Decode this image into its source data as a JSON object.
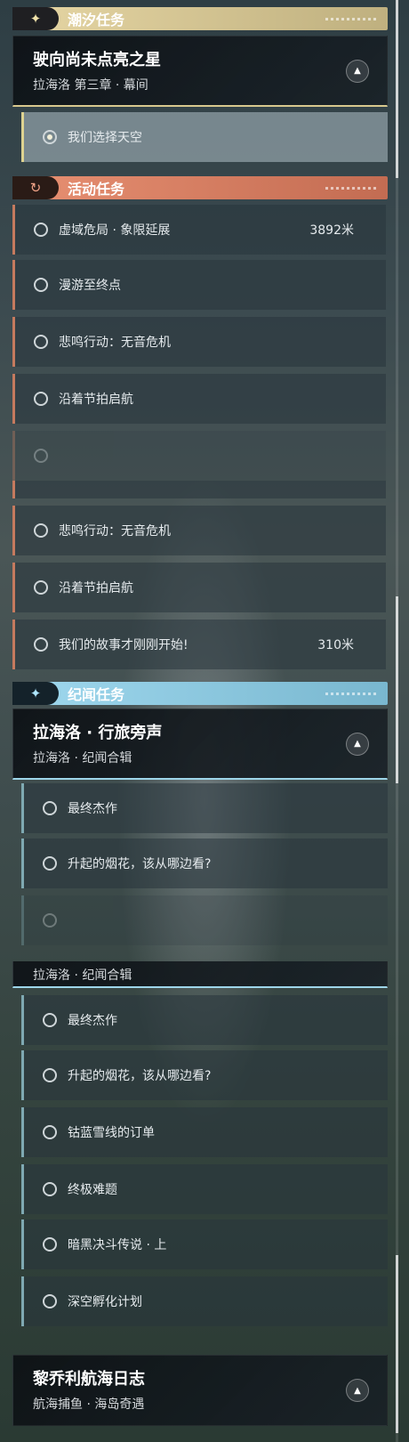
{
  "tide_section": {
    "icon": "sparkle-icon",
    "title": "潮汐任务",
    "card": {
      "title": "驶向尚未点亮之星",
      "subtitle": "拉海洛 第三章 · 幕间"
    },
    "selected_quest": "我们选择天空"
  },
  "event_section": {
    "icon": "refresh-quest-icon",
    "title": "活动任务",
    "quests": [
      {
        "name": "虚域危局 · 象限延展",
        "distance": "3892米"
      },
      {
        "name": "漫游至终点",
        "distance": ""
      },
      {
        "name": "悲鸣行动：无音危机",
        "distance": ""
      },
      {
        "name": "沿着节拍启航",
        "distance": ""
      },
      {
        "name": "我们的故事才刚刚开始!",
        "distance": "310米"
      }
    ]
  },
  "story_section": {
    "icon": "sparkle-icon",
    "title": "纪闻任务",
    "card": {
      "title": "拉海洛 · 行旅旁声",
      "subtitle": "拉海洛 · 纪闻合辑"
    },
    "quests": [
      {
        "name": "最终杰作"
      },
      {
        "name": "升起的烟花，该从哪边看?"
      },
      {
        "name": "钴蓝雪线的订单"
      },
      {
        "name": "终极难题"
      },
      {
        "name": "暗黑决斗传说 · 上"
      },
      {
        "name": "深空孵化计划"
      }
    ]
  },
  "log_card": {
    "title": "黎乔利航海日志",
    "subtitle": "航海捕鱼 · 海岛奇遇"
  },
  "colors": {
    "tide": "#e6d6a4",
    "event": "#e89072",
    "story": "#9fd8ee"
  }
}
